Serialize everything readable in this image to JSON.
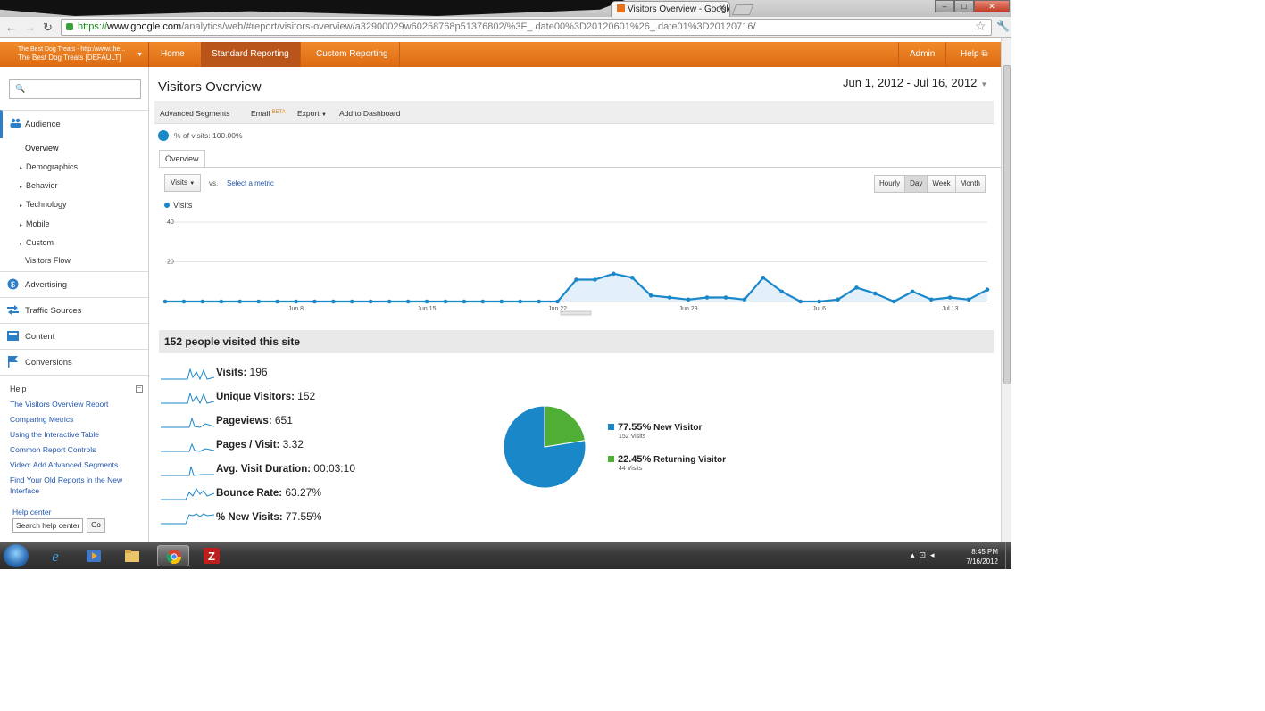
{
  "browser": {
    "tab_title": "Visitors Overview - Google",
    "url_scheme": "https://",
    "url_domain": "www.google.com",
    "url_path": "/analytics/web/#report/visitors-overview/a32900029w60258768p51376802/%3F_.date00%3D20120601%26_.date01%3D20120716/"
  },
  "ga": {
    "account_line1": "The Best Dog Treats - http://www.the...",
    "account_line2": "The Best Dog Treats [DEFAULT]",
    "nav": {
      "home": "Home",
      "standard": "Standard Reporting",
      "custom": "Custom Reporting",
      "admin": "Admin",
      "help": "Help"
    }
  },
  "sidebar": {
    "audience": "Audience",
    "audience_items": [
      {
        "label": "Overview"
      },
      {
        "label": "Demographics"
      },
      {
        "label": "Behavior"
      },
      {
        "label": "Technology"
      },
      {
        "label": "Mobile"
      },
      {
        "label": "Custom"
      },
      {
        "label": "Visitors Flow"
      }
    ],
    "advertising": "Advertising",
    "traffic_sources": "Traffic Sources",
    "content": "Content",
    "conversions": "Conversions",
    "help_title": "Help",
    "help_links": [
      "The Visitors Overview Report",
      "Comparing Metrics",
      "Using the Interactive Table",
      "Common Report Controls",
      "Video: Add Advanced Segments",
      "Find Your Old Reports in the New Interface"
    ],
    "help_center": "Help center",
    "help_search_value": "Search help center",
    "go": "Go"
  },
  "main": {
    "title": "Visitors Overview",
    "date_range": "Jun 1, 2012 - Jul 16, 2012",
    "toolbar": {
      "segments": "Advanced Segments",
      "email": "Email",
      "beta": "BETA",
      "export": "Export",
      "dashboard": "Add to Dashboard"
    },
    "segment_text": "% of visits: 100.00%",
    "tab_overview": "Overview",
    "metric_select": "Visits",
    "vs": "vs.",
    "select_metric": "Select a metric",
    "granularity": [
      "Hourly",
      "Day",
      "Week",
      "Month"
    ],
    "legend": "Visits",
    "summary_title": "152 people visited this site",
    "metrics": [
      {
        "label": "Visits:",
        "value": "196"
      },
      {
        "label": "Unique Visitors:",
        "value": "152"
      },
      {
        "label": "Pageviews:",
        "value": "651"
      },
      {
        "label": "Pages / Visit:",
        "value": "3.32"
      },
      {
        "label": "Avg. Visit Duration:",
        "value": "00:03:10"
      },
      {
        "label": "Bounce Rate:",
        "value": "63.27%"
      },
      {
        "label": "% New Visits:",
        "value": "77.55%"
      }
    ],
    "pie_legend": [
      {
        "pct": "77.55%",
        "label": "New Visitor",
        "count": "152 Visits",
        "color": "#1a87c9"
      },
      {
        "pct": "22.45%",
        "label": "Returning Visitor",
        "count": "44 Visits",
        "color": "#4eae35"
      }
    ]
  },
  "chart_data": {
    "type": "area",
    "x_tick_labels": [
      "Jun 8",
      "Jun 15",
      "Jun 22",
      "Jun 29",
      "Jul 6",
      "Jul 13"
    ],
    "y_tick_labels": [
      "40",
      "20"
    ],
    "ylim": [
      0,
      40
    ],
    "series": [
      {
        "name": "Visits",
        "color": "#1a87c9",
        "values": [
          0,
          0,
          0,
          0,
          0,
          0,
          0,
          0,
          0,
          0,
          0,
          0,
          0,
          0,
          0,
          0,
          0,
          0,
          0,
          0,
          0,
          0,
          11,
          11,
          14,
          12,
          3,
          2,
          1,
          2,
          2,
          1,
          12,
          5,
          0,
          0,
          1,
          7,
          4,
          0,
          5,
          1,
          2,
          1,
          6
        ]
      }
    ],
    "pie": {
      "type": "pie",
      "values": [
        77.55,
        22.45
      ],
      "colors": [
        "#1a87c9",
        "#4eae35"
      ]
    }
  },
  "taskbar": {
    "time": "8:45 PM",
    "date": "7/16/2012"
  }
}
